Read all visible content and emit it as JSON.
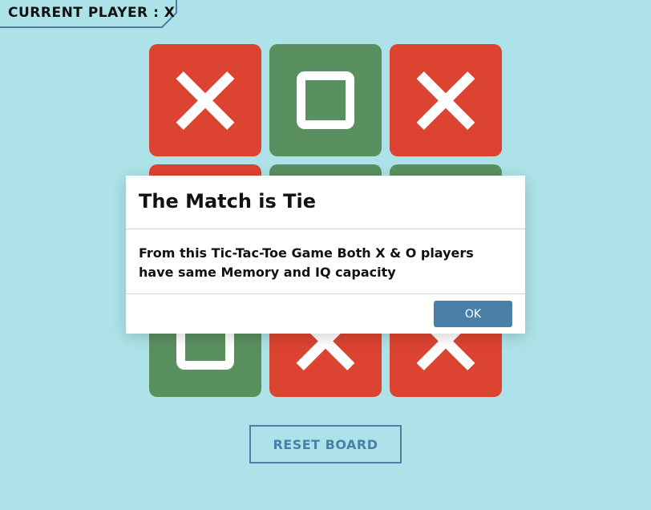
{
  "header": {
    "current_player_label": "CURRENT PLAYER : X"
  },
  "board": {
    "cells": [
      "X",
      "O",
      "X",
      "X",
      "O",
      "O",
      "O",
      "X",
      "X"
    ]
  },
  "reset_button": {
    "label": "RESET BOARD"
  },
  "modal": {
    "title": "The Match is Tie",
    "message": "From this Tic-Tac-Toe Game Both X & O players have same Memory and IQ capacity",
    "ok_label": "OK"
  },
  "colors": {
    "background": "#ade3e8",
    "x_cell": "#dc4431",
    "o_cell": "#5a9060",
    "accent": "#4a7fa8"
  }
}
